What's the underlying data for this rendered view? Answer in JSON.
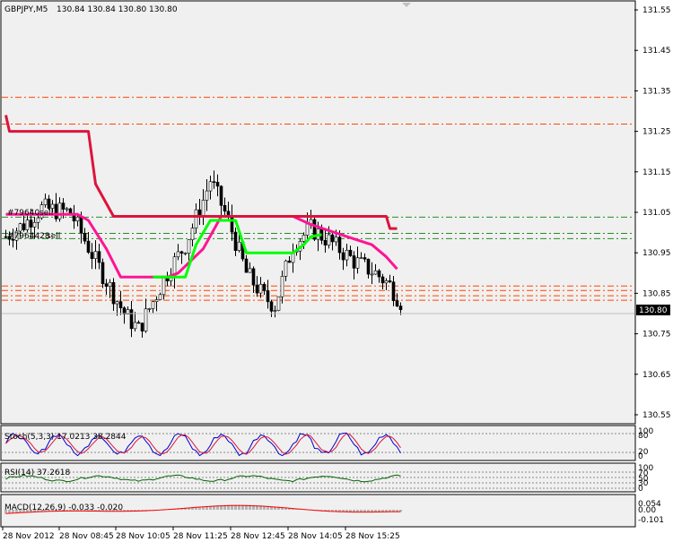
{
  "header": {
    "symbol": "GBPJPY,M5",
    "ohlc": "130.84 130.84 130.80 130.80"
  },
  "price_labels": {
    "current": "130.80",
    "ticket_a": "#79640",
    "ticket_a_suffix": "sell",
    "ticket_b": "#7964428",
    "ticket_b_suffix": "sell"
  },
  "indicators": {
    "stoch": {
      "label": "Stoch(5,3,3) 17.0213 38.2844",
      "levels": [
        "100",
        "80",
        "20",
        "0"
      ]
    },
    "rsi": {
      "label": "RSI(14) 37.2618",
      "levels": [
        "100",
        "70",
        "50",
        "30",
        "0"
      ]
    },
    "macd": {
      "label": "MACD(12,26,9) -0.033 -0.020",
      "levels": [
        "0.054",
        "0.00",
        "-0.101"
      ]
    }
  },
  "colors": {
    "background": "#ffffff",
    "panel_bg": "#f0f0f0",
    "candle": "#000000",
    "upper_channel": "#dc143c",
    "middle_line": "#ff1493",
    "lower_line": "#00ff00",
    "order_lines": "#ff4500",
    "green_levels": "#228b22",
    "stoch_main": "#0000cd",
    "stoch_signal": "#dc143c",
    "rsi_line": "#006400",
    "macd_hist": "#b4b4b4",
    "macd_signal": "#ff0000"
  },
  "chart_data": {
    "type": "candlestick",
    "title": "GBPJPY,M5",
    "ylim": [
      130.53,
      131.57
    ],
    "y_ticks": [
      "131.55",
      "131.45",
      "131.35",
      "131.25",
      "131.15",
      "131.05",
      "130.95",
      "130.85",
      "130.75",
      "130.65",
      "130.55"
    ],
    "x_labels": [
      "28 Nov 2012",
      "28 Nov 08:45",
      "28 Nov 10:05",
      "28 Nov 11:25",
      "28 Nov 12:45",
      "28 Nov 14:05",
      "28 Nov 15:25"
    ],
    "horizontal_levels": {
      "orange_dashdot": [
        131.334,
        131.268,
        130.868,
        130.857,
        130.844,
        130.833
      ],
      "green_dashdot": [
        131.038,
        130.998,
        130.985
      ]
    },
    "upper_channel": [
      [
        0,
        131.29
      ],
      [
        1,
        131.25
      ],
      [
        23,
        131.25
      ],
      [
        25,
        131.12
      ],
      [
        30,
        131.04
      ],
      [
        106,
        131.04
      ],
      [
        107,
        131.01
      ],
      [
        109,
        131.01
      ]
    ],
    "middle_line": [
      [
        0,
        131.045
      ],
      [
        20,
        131.045
      ],
      [
        23,
        131.03
      ],
      [
        28,
        130.96
      ],
      [
        32,
        130.89
      ],
      [
        45,
        130.89
      ],
      [
        48,
        130.9
      ],
      [
        55,
        130.96
      ],
      [
        60,
        131.04
      ],
      [
        80,
        131.04
      ],
      [
        85,
        131.02
      ],
      [
        95,
        130.99
      ],
      [
        102,
        130.97
      ],
      [
        106,
        130.94
      ],
      [
        109,
        130.91
      ]
    ],
    "lower_line": [
      [
        41,
        130.89
      ],
      [
        50,
        130.89
      ],
      [
        53,
        130.97
      ],
      [
        55,
        131.0
      ],
      [
        57,
        131.03
      ],
      [
        64,
        131.03
      ],
      [
        67,
        130.95
      ],
      [
        80,
        130.95
      ],
      [
        83,
        130.97
      ],
      [
        85,
        130.99
      ],
      [
        88,
        130.995
      ]
    ]
  }
}
